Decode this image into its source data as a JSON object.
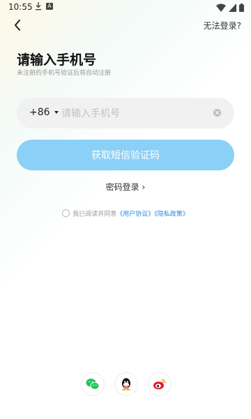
{
  "status_bar": {
    "time": "10:55",
    "a_badge": "A"
  },
  "header": {
    "back_icon": "back-arrow-icon",
    "cant_login_label": "无法登录?"
  },
  "page": {
    "title": "请输入手机号",
    "subtitle": "未注册的手机号验证后将自动注册"
  },
  "phone_form": {
    "country_code": "+86",
    "phone_value": "",
    "phone_placeholder": "请输入手机号"
  },
  "sms_button": {
    "label": "获取短信验证码",
    "color": "#8bd0f7"
  },
  "password_login": {
    "label": "密码登录",
    "chevron": "›"
  },
  "agreement": {
    "prefix": "我已阅读并同意",
    "user_agreement": "《用户协议》",
    "privacy_policy": "《隐私政策》"
  },
  "social_login": {
    "items": [
      {
        "name": "wechat",
        "icon": "wechat-icon",
        "color": "#1fc25a"
      },
      {
        "name": "qq",
        "icon": "qq-icon",
        "color": "#111111"
      },
      {
        "name": "weibo",
        "icon": "weibo-icon",
        "color": "#e6162d"
      }
    ]
  }
}
